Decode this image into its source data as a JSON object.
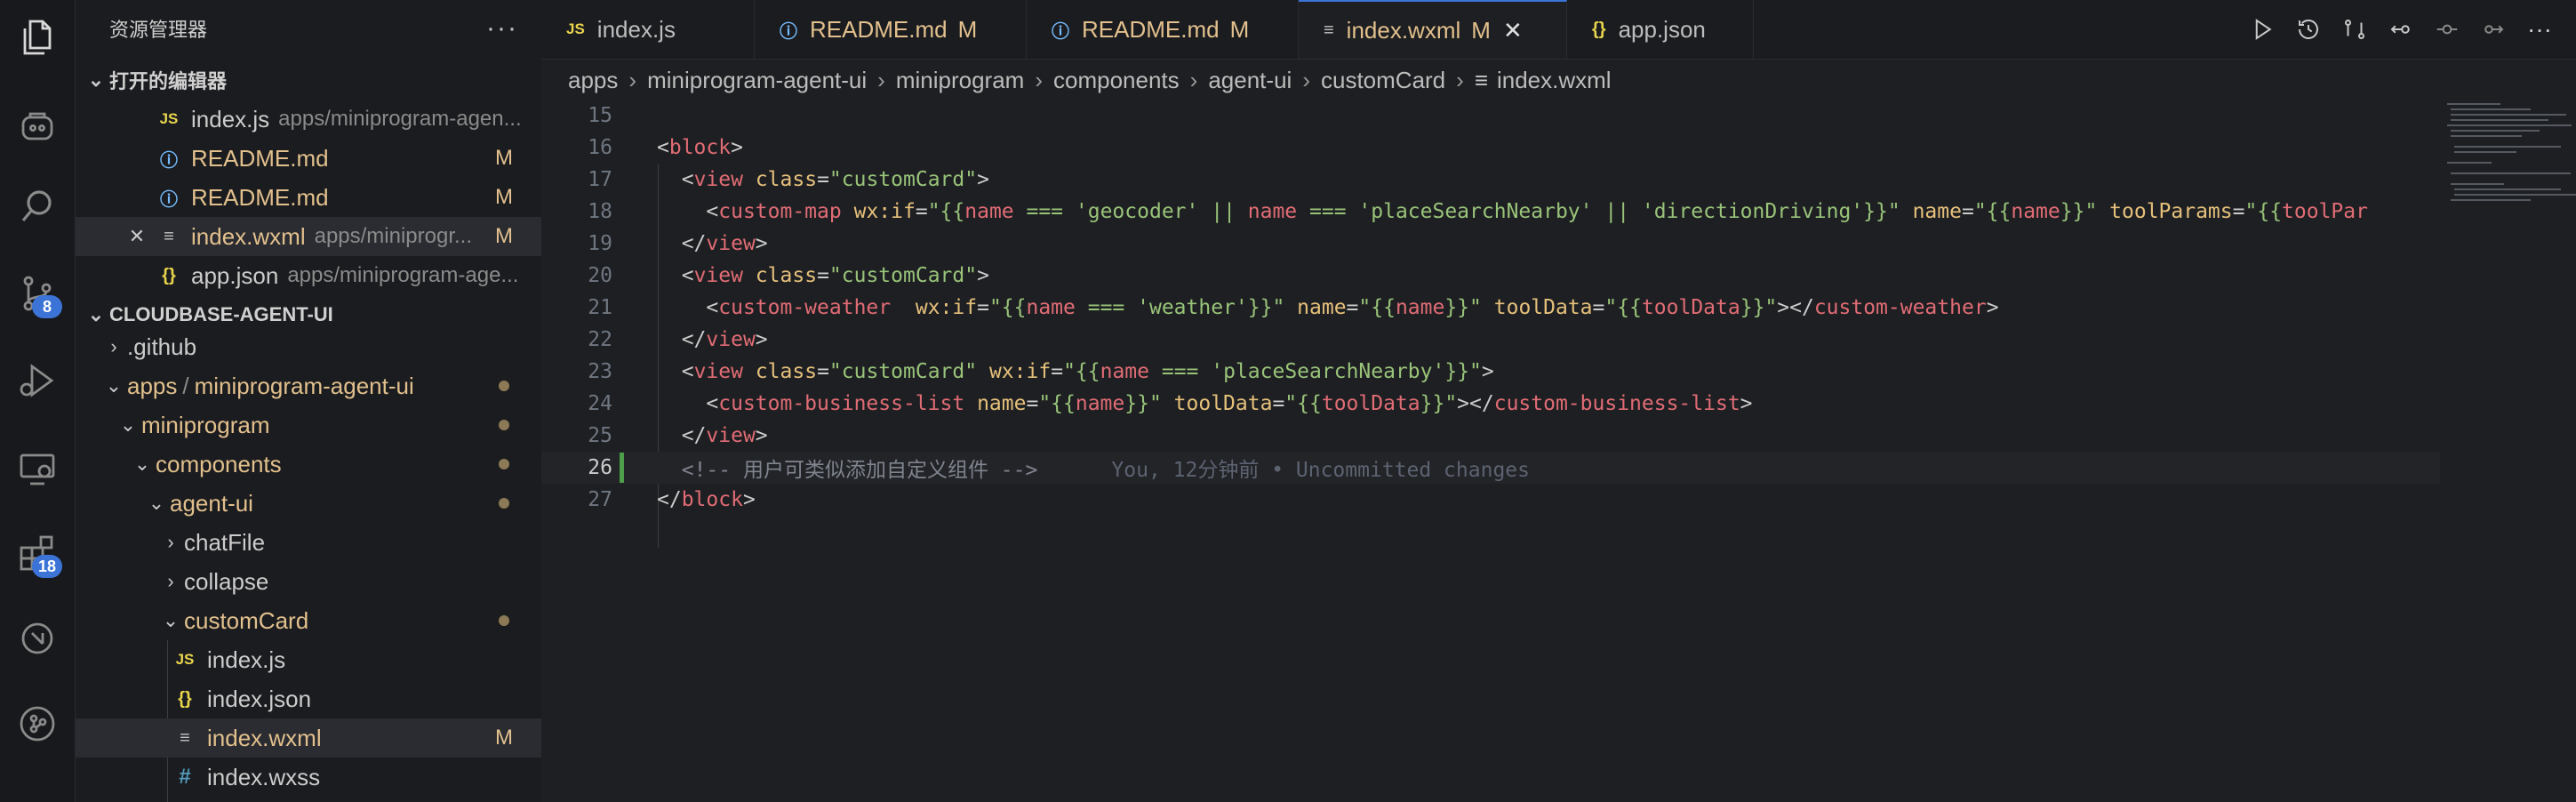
{
  "activity": {
    "scm_badge": "8",
    "extensions_badge": "18"
  },
  "sidebar": {
    "title": "资源管理器",
    "open_editors_label": "打开的编辑器",
    "open_editors": [
      {
        "icon": "JS",
        "name": "index.js",
        "path": "apps/miniprogram-agen...",
        "mark": ""
      },
      {
        "icon": "ⓘ",
        "name": "README.md",
        "path": "",
        "mark": "M"
      },
      {
        "icon": "ⓘ",
        "name": "README.md",
        "path": "",
        "mark": "M"
      },
      {
        "icon": "≡",
        "name": "index.wxml",
        "path": "apps/miniprogr...",
        "mark": "M"
      },
      {
        "icon": "{}",
        "name": "app.json",
        "path": "apps/miniprogram-age...",
        "mark": ""
      }
    ],
    "workspace_label": "CLOUDBASE-AGENT-UI",
    "tree": {
      "github": ".github",
      "apps": "apps",
      "apps_sep": "/",
      "agent_ui_pkg": "miniprogram-agent-ui",
      "miniprogram": "miniprogram",
      "components": "components",
      "agent_ui": "agent-ui",
      "chatFile": "chatFile",
      "collapse": "collapse",
      "customCard": "customCard",
      "f_js": "index.js",
      "f_json": "index.json",
      "f_wxml": "index.wxml",
      "f_wxml_mark": "M",
      "f_wxss": "index.wxss"
    }
  },
  "tabs": [
    {
      "icon": "JS",
      "label": "index.js",
      "mark": ""
    },
    {
      "icon": "ⓘ",
      "label": "README.md",
      "mark": "M"
    },
    {
      "icon": "ⓘ",
      "label": "README.md",
      "mark": "M"
    },
    {
      "icon": "≡",
      "label": "index.wxml",
      "mark": "M"
    },
    {
      "icon": "{}",
      "label": "app.json",
      "mark": ""
    }
  ],
  "breadcrumb": [
    "apps",
    "miniprogram-agent-ui",
    "miniprogram",
    "components",
    "agent-ui",
    "customCard",
    "index.wxml"
  ],
  "editor": {
    "lines": [
      {
        "n": "15"
      },
      {
        "n": "16"
      },
      {
        "n": "17"
      },
      {
        "n": "18"
      },
      {
        "n": "19"
      },
      {
        "n": "20"
      },
      {
        "n": "21"
      },
      {
        "n": "22"
      },
      {
        "n": "23"
      },
      {
        "n": "24"
      },
      {
        "n": "25"
      },
      {
        "n": "26"
      },
      {
        "n": "27"
      }
    ],
    "tokens": {
      "block": "block",
      "view": "view",
      "class_attr": "class",
      "customCard_str": "\"customCard\"",
      "custom_map": "custom-map",
      "wxif": "wx:if",
      "l18_cond_open": "\"{{",
      "name": "name",
      "op_eq": " === ",
      "s_geocoder": "'geocoder'",
      "op_or": " || ",
      "s_place": "'placeSearchNearby'",
      "s_direction": "'directionDriving'",
      "cond_close": "}}\"",
      "name_attr": "name",
      "tmpl_name_open": "\"{{",
      "tmpl_close": "}}\"",
      "toolParams_attr": "toolParams",
      "toolPar_cut": "toolPar",
      "custom_weather": "custom-weather",
      "s_weather": "'weather'",
      "toolData_attr": "toolData",
      "toolData": "toolData",
      "custom_business_list": "custom-business-list",
      "comment": "<!-- 用户可类似添加自定义组件 -->",
      "blame": "You, 12分钟前 • Uncommitted changes"
    }
  }
}
